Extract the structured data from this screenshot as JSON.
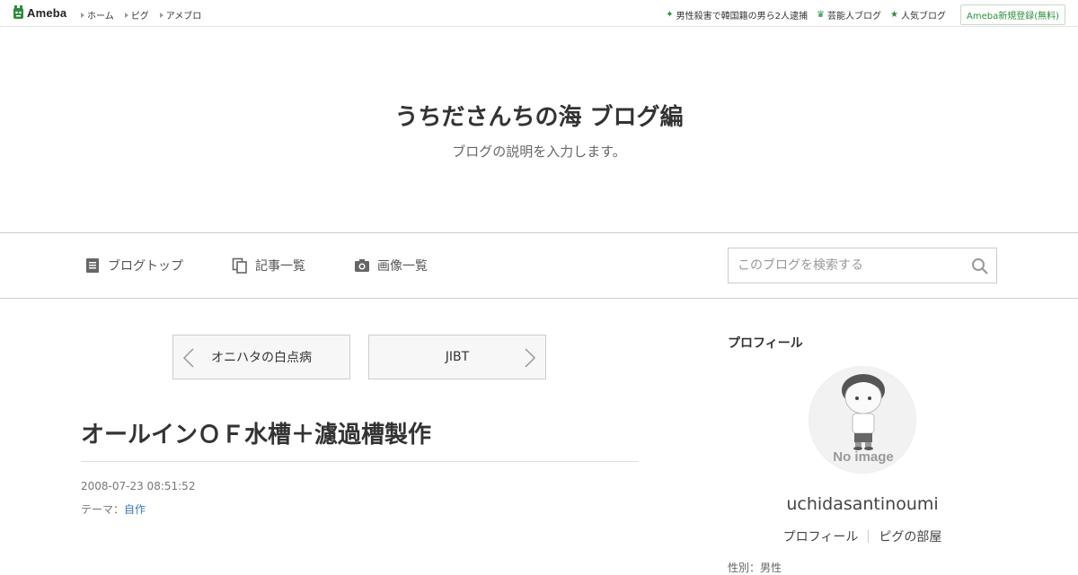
{
  "topbar": {
    "logo_text": "Ameba",
    "nav": [
      "ホーム",
      "ピグ",
      "アメブロ"
    ],
    "right_links": [
      {
        "icon": "sparkle-icon",
        "label": "男性殺害で韓国籍の男ら2人逮捕"
      },
      {
        "icon": "crown-icon",
        "label": "芸能人ブログ"
      },
      {
        "icon": "star-icon",
        "label": "人気ブログ"
      }
    ],
    "register_label": "Ameba新規登録(無料)"
  },
  "header": {
    "title": "うちださんちの海 ブログ編",
    "description": "ブログの説明を入力します。"
  },
  "nav": {
    "blog_top": "ブログトップ",
    "articles": "記事一覧",
    "images": "画像一覧",
    "search_placeholder": "このブログを検索する"
  },
  "article": {
    "prev_label": "オニハタの白点病",
    "next_label": "JIBT",
    "title": "オールインＯＦ水槽＋濾過槽製作",
    "date": "2008-07-23 08:51:52",
    "theme_prefix": "テーマ：",
    "theme_link": "自作"
  },
  "sidebar": {
    "heading": "プロフィール",
    "avatar_caption": "No image",
    "username": "uchidasantinoumi",
    "links": [
      "プロフィール",
      "ピグの部屋"
    ],
    "cut_text": "性別：男性"
  },
  "colors": {
    "brand_green": "#2d8c3c",
    "link_blue": "#3a7bbf"
  }
}
